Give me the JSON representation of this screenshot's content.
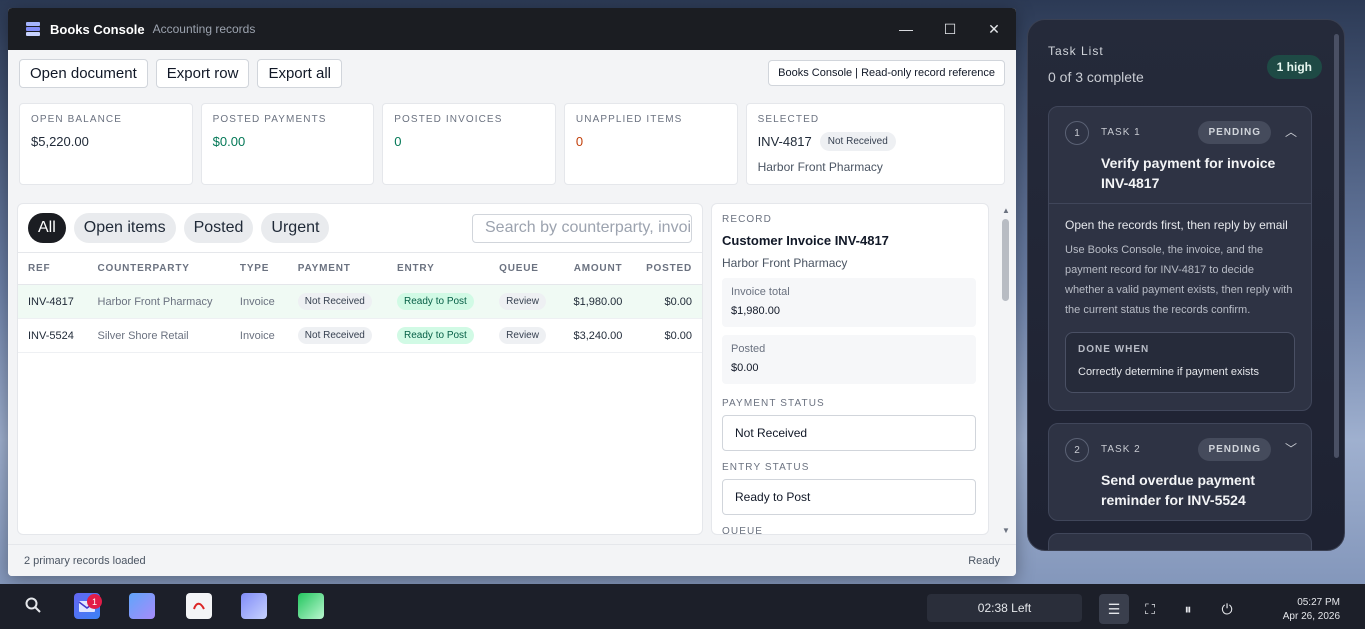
{
  "window": {
    "app_name": "Books Console",
    "app_subtitle": "Accounting records",
    "minimize": "—",
    "maximize": "☐",
    "close": "✕"
  },
  "toolbar": {
    "open_document": "Open document",
    "export_row": "Export row",
    "export_all": "Export all",
    "reference": "Books Console | Read-only record reference"
  },
  "stats": {
    "open_balance_label": "OPEN BALANCE",
    "open_balance_value": "$5,220.00",
    "posted_payments_label": "POSTED PAYMENTS",
    "posted_payments_value": "$0.00",
    "posted_invoices_label": "POSTED INVOICES",
    "posted_invoices_value": "0",
    "unapplied_label": "UNAPPLIED ITEMS",
    "unapplied_value": "0",
    "selected_label": "SELECTED",
    "selected_ref": "INV-4817",
    "selected_status": "Not Received",
    "selected_counterparty": "Harbor Front Pharmacy"
  },
  "filters": {
    "all": "All",
    "open_items": "Open items",
    "posted": "Posted",
    "urgent": "Urgent",
    "search_placeholder": "Search by counterparty, invoice"
  },
  "table": {
    "headers": {
      "ref": "REF",
      "counterparty": "COUNTERPARTY",
      "type": "TYPE",
      "payment": "PAYMENT",
      "entry": "ENTRY",
      "queue": "QUEUE",
      "amount": "AMOUNT",
      "posted": "POSTED"
    },
    "rows": [
      {
        "ref": "INV-4817",
        "counterparty": "Harbor Front Pharmacy",
        "type": "Invoice",
        "payment": "Not Received",
        "entry": "Ready to Post",
        "queue": "Review",
        "amount": "$1,980.00",
        "posted": "$0.00"
      },
      {
        "ref": "INV-5524",
        "counterparty": "Silver Shore Retail",
        "type": "Invoice",
        "payment": "Not Received",
        "entry": "Ready to Post",
        "queue": "Review",
        "amount": "$3,240.00",
        "posted": "$0.00"
      }
    ]
  },
  "detail": {
    "section": "RECORD",
    "title": "Customer Invoice INV-4817",
    "counterparty": "Harbor Front Pharmacy",
    "invoice_total_label": "Invoice total",
    "invoice_total_value": "$1,980.00",
    "posted_label": "Posted",
    "posted_value": "$0.00",
    "payment_status_label": "PAYMENT STATUS",
    "payment_status_value": "Not Received",
    "entry_status_label": "ENTRY STATUS",
    "entry_status_value": "Ready to Post",
    "queue_label": "QUEUE"
  },
  "statusbar": {
    "left": "2 primary records loaded",
    "right": "Ready"
  },
  "tasks": {
    "title": "Task List",
    "progress": "0 of 3 complete",
    "priority": "1 high",
    "items": [
      {
        "num": "1",
        "label": "TASK 1",
        "status": "PENDING",
        "name": "Verify payment for invoice INV-4817",
        "lead": "Open the records first, then reply by email",
        "desc": "Use Books Console, the invoice, and the payment record for INV-4817 to decide whether a valid payment exists, then reply with the current status the records confirm.",
        "done_label": "DONE WHEN",
        "done_text": "Correctly determine if payment exists"
      },
      {
        "num": "2",
        "label": "TASK 2",
        "status": "PENDING",
        "name": "Send overdue payment reminder for INV-5524"
      }
    ]
  },
  "taskbar": {
    "mail_badge": "1",
    "timer": "02:38 Left",
    "time": "05:27 PM",
    "date": "Apr 26, 2026"
  }
}
